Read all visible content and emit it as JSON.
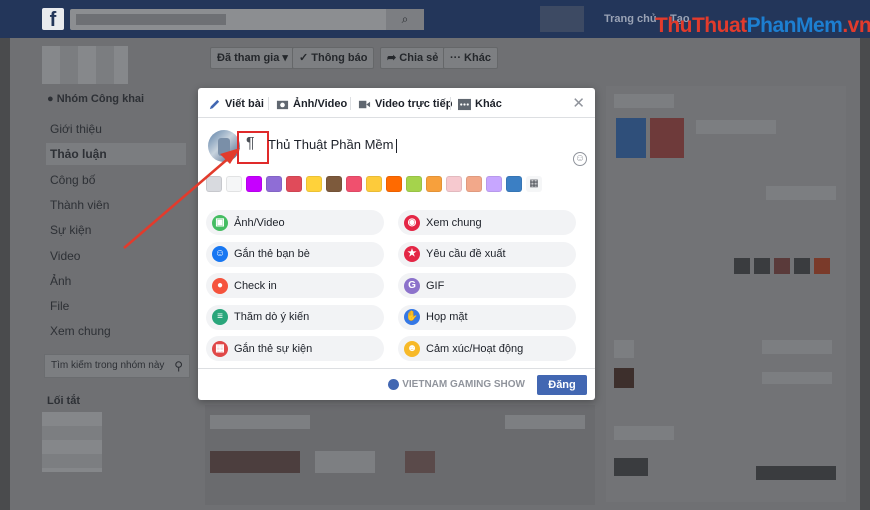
{
  "topbar": {
    "logo": "f",
    "home_label": "Trang chủ",
    "create_label": "Tạo"
  },
  "watermark": {
    "part1": "Thu",
    "part2": "Thuat",
    "part3": "PhanMem",
    "part4": ".vn"
  },
  "group": {
    "type_label": "Nhóm Công khai",
    "nav_items": [
      "Giới thiệu",
      "Thảo luận",
      "Công bố",
      "Thành viên",
      "Sự kiện",
      "Video",
      "Ảnh",
      "File",
      "Xem chung"
    ],
    "active_item": "Thảo luận",
    "search_placeholder": "Tìm kiếm trong nhóm này",
    "shortcuts_label": "Lối tắt"
  },
  "action_bar": {
    "joined": "Đã tham gia ▾",
    "notify": "✓ Thông báo",
    "share": "Chia sẻ",
    "more": "··· Khác"
  },
  "composer": {
    "tabs": [
      "Viết bài",
      "Ảnh/Video",
      "Video trực tiếp",
      "Khác"
    ],
    "pilcrow": "¶",
    "text": "Thủ Thuật Phần Mềm",
    "backgrounds": [
      "#d8dadf",
      "#f5f6f7",
      "#c600ff",
      "#8f6dd6",
      "#e04b5a",
      "#ffd23a",
      "#7d5a3c",
      "#f0506e",
      "#fdcb3b",
      "#ff6a00",
      "#a5d34c",
      "#f7a03c",
      "#f6c9cf",
      "#f2a88a",
      "#c7a6ff",
      "#3b7fc4"
    ],
    "options": [
      {
        "label": "Ảnh/Video",
        "icon": "photo-icon",
        "color": "#45bd62"
      },
      {
        "label": "Xem chung",
        "icon": "popcorn-icon",
        "color": "#e42645"
      },
      {
        "label": "Gắn thẻ bạn bè",
        "icon": "tag-friends-icon",
        "color": "#1877f2"
      },
      {
        "label": "Yêu cầu đề xuất",
        "icon": "recommend-icon",
        "color": "#e42645"
      },
      {
        "label": "Check in",
        "icon": "location-pin-icon",
        "color": "#f5533d"
      },
      {
        "label": "GIF",
        "icon": "gif-icon",
        "color": "#8c72cb"
      },
      {
        "label": "Thăm dò ý kiến",
        "icon": "poll-icon",
        "color": "#2aa67b"
      },
      {
        "label": "Họp mặt",
        "icon": "wave-hand-icon",
        "color": "#3578e5"
      },
      {
        "label": "Gắn thẻ sự kiện",
        "icon": "calendar-icon",
        "color": "#e04848"
      },
      {
        "label": "Cảm xúc/Hoạt động",
        "icon": "emoji-icon",
        "color": "#f7b928"
      }
    ],
    "audience": "VIETNAM GAMING SHOW",
    "post_label": "Đăng"
  }
}
